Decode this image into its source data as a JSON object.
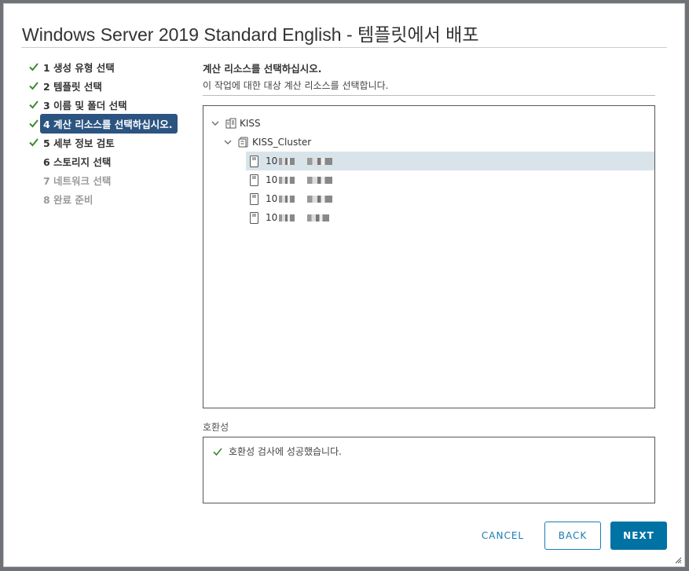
{
  "dialog": {
    "title": "Windows Server 2019 Standard English - 템플릿에서 배포"
  },
  "steps": [
    {
      "label": "1 생성 유형 선택",
      "state": "done"
    },
    {
      "label": "2 템플릿 선택",
      "state": "done"
    },
    {
      "label": "3 이름 및 폴더 선택",
      "state": "done"
    },
    {
      "label": "4 계산 리소스를 선택하십시오.",
      "state": "active"
    },
    {
      "label": "5 세부 정보 검토",
      "state": "done"
    },
    {
      "label": "6 스토리지 선택",
      "state": "pending"
    },
    {
      "label": "7 네트워크 선택",
      "state": "disabled"
    },
    {
      "label": "8 완료 준비",
      "state": "disabled"
    }
  ],
  "main": {
    "heading": "계산 리소스를 선택하십시오.",
    "subheading": "이 작업에 대한 대상 계산 리소스를 선택합니다."
  },
  "tree": {
    "datacenter": {
      "label": "KISS",
      "icon": "datacenter-icon"
    },
    "cluster": {
      "label": "KISS_Cluster",
      "icon": "cluster-icon"
    },
    "hosts": [
      {
        "label": "10",
        "selected": true
      },
      {
        "label": "10",
        "selected": false
      },
      {
        "label": "10",
        "selected": false
      },
      {
        "label": "10",
        "selected": false
      }
    ]
  },
  "compatibility": {
    "label": "호환성",
    "message": "호환성 검사에 성공했습니다."
  },
  "buttons": {
    "cancel": "CANCEL",
    "back": "BACK",
    "next": "NEXT"
  },
  "colors": {
    "accent": "#0072a3",
    "active_step": "#2c5481",
    "check": "#3c8a2e",
    "selected_row": "#d9e4ea"
  }
}
